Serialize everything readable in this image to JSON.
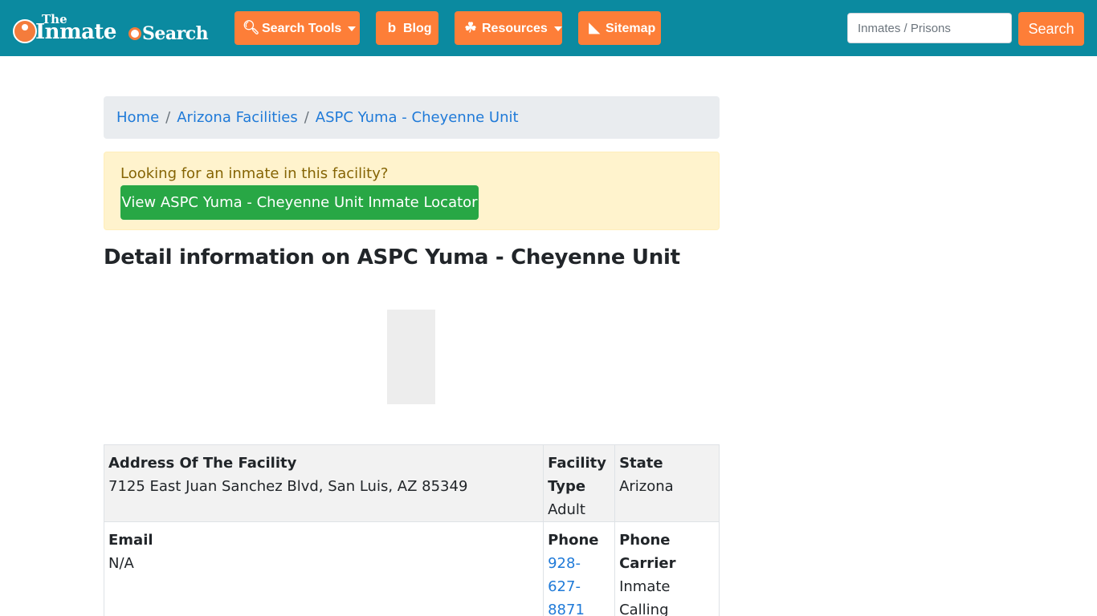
{
  "brand": {
    "the": "The",
    "inmate": "Inmate",
    "search": "Search"
  },
  "nav": {
    "search_tools": "Search Tools",
    "blog": "Blog",
    "resources": "Resources",
    "sitemap": "Sitemap",
    "search_placeholder": "Inmates / Prisons",
    "search_button": "Search"
  },
  "breadcrumb": {
    "items": [
      "Home",
      "Arizona Facilities",
      "ASPC Yuma - Cheyenne Unit"
    ],
    "separator": "/"
  },
  "alert": {
    "message": "Looking for an inmate in this facility?",
    "button": "View ASPC Yuma - Cheyenne Unit Inmate Locator"
  },
  "title": "Detail information on ASPC Yuma - Cheyenne Unit",
  "details": {
    "address_label": "Address Of The Facility",
    "address_value": "7125 East Juan Sanchez Blvd, San Luis, AZ 85349",
    "facility_type_label": "Facility Type",
    "facility_type_value": "Adult",
    "state_label": "State",
    "state_value": "Arizona",
    "email_label": "Email",
    "email_value": "N/A",
    "phone_label": "Phone",
    "phone_value": "928-627-8871",
    "carrier_label": "Phone Carrier",
    "carrier_value": "Inmate Calling"
  },
  "colors": {
    "navbar": "#0b8aa0",
    "accent": "#fd7e38",
    "success": "#28a745",
    "link": "#1f7ad8"
  }
}
